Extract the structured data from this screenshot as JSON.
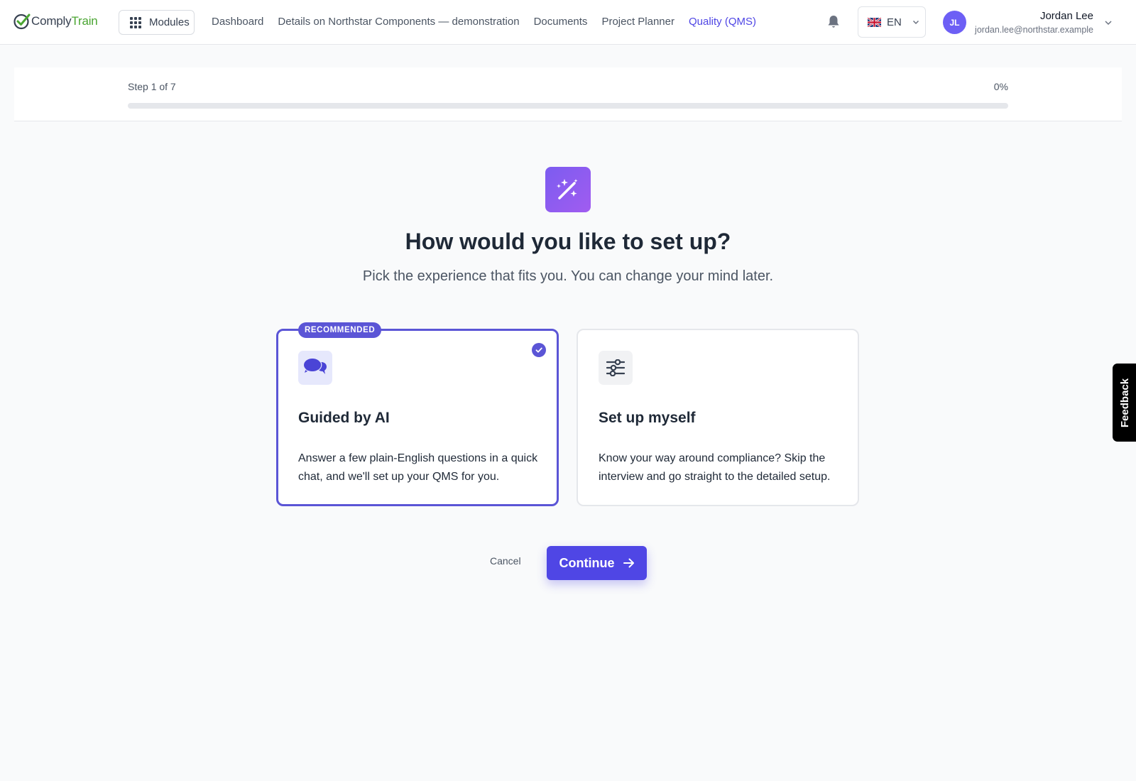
{
  "app": {
    "logo_part1": "Comply",
    "logo_part2": "Train"
  },
  "nav": {
    "modules_label": "Modules",
    "links": [
      {
        "label": "Dashboard",
        "active": false
      },
      {
        "label": "Details on Northstar Components — demonstration",
        "active": false
      },
      {
        "label": "Documents",
        "active": false
      },
      {
        "label": "Project Planner",
        "active": false
      },
      {
        "label": "Quality (QMS)",
        "active": true
      }
    ],
    "language": "EN",
    "user": {
      "initials": "JL",
      "name": "Jordan Lee",
      "email": "jordan.lee@northstar.example"
    }
  },
  "progress": {
    "step_text": "Step 1 of 7",
    "percent_text": "0%",
    "percent": 0
  },
  "hero": {
    "icon": "magic-wand-icon",
    "title": "How would you like to set up?",
    "subtitle": "Pick the experience that fits you. You can change your mind later."
  },
  "options": [
    {
      "badge": "RECOMMENDED",
      "icon": "chat-bubbles-icon",
      "title": "Guided by AI",
      "description": "Answer a few plain-English questions in a quick chat, and we'll set up your QMS for you.",
      "selected": true
    },
    {
      "icon": "sliders-icon",
      "title": "Set up myself",
      "description": "Know your way around compliance? Skip the interview and go straight to the detailed setup.",
      "selected": false
    }
  ],
  "actions": {
    "cancel_label": "Cancel",
    "continue_label": "Continue"
  },
  "feedback_label": "Feedback",
  "colors": {
    "accent": "#4f46e5",
    "brand_green": "#4aa532",
    "avatar": "#6d5ff5"
  }
}
